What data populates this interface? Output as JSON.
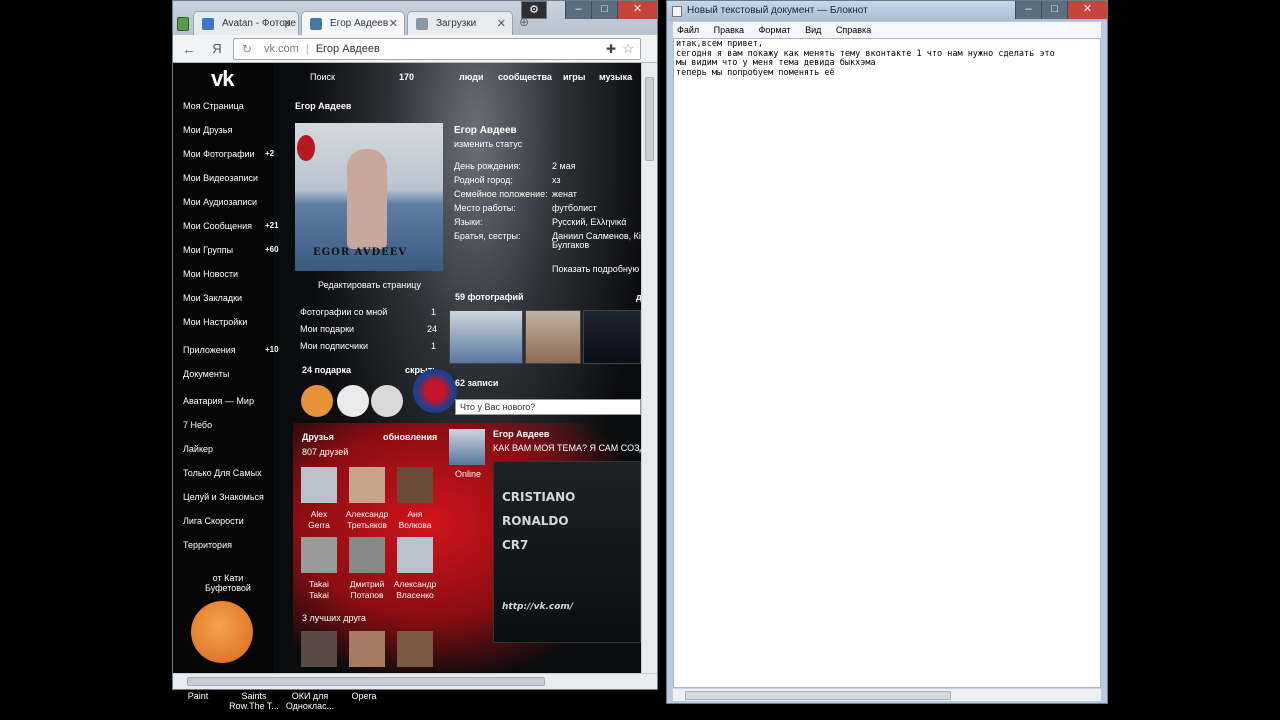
{
  "browser": {
    "tabs": [
      {
        "label": "Avatan - Фоторе"
      },
      {
        "label": "Егор Авдеев"
      },
      {
        "label": "Загрузки"
      }
    ],
    "url_domain": "vk.com",
    "url_title": "Егор Авдеев",
    "back_icon": "arrow-left-icon",
    "yandex_label": "Я"
  },
  "vk": {
    "logo": "vk",
    "topnav": {
      "search": "Поиск",
      "count": "170",
      "people": "люди",
      "communities": "сообщества",
      "games": "игры",
      "music": "музыка"
    },
    "menu": [
      {
        "label": "Моя Страница",
        "badge": ""
      },
      {
        "label": "Мои Друзья",
        "badge": ""
      },
      {
        "label": "Мои Фотографии",
        "badge": "+2"
      },
      {
        "label": "Мои Видеозаписи",
        "badge": ""
      },
      {
        "label": "Мои Аудиозаписи",
        "badge": ""
      },
      {
        "label": "Мои Сообщения",
        "badge": "+21"
      },
      {
        "label": "Мои Группы",
        "badge": "+60"
      },
      {
        "label": "Мои Новости",
        "badge": ""
      },
      {
        "label": "Мои Закладки",
        "badge": ""
      },
      {
        "label": "Мои Настройки",
        "badge": ""
      },
      {
        "label": "Приложения",
        "badge": "+10"
      },
      {
        "label": "Документы",
        "badge": ""
      },
      {
        "label": "Аватария — Мир",
        "badge": ""
      },
      {
        "label": "7 Небо",
        "badge": ""
      },
      {
        "label": "Лайкер",
        "badge": ""
      },
      {
        "label": "Только Для Самых",
        "badge": ""
      },
      {
        "label": "Целуй и Знакомься",
        "badge": ""
      },
      {
        "label": "Лига Скорости",
        "badge": ""
      },
      {
        "label": "Территория",
        "badge": ""
      }
    ],
    "gift_from": "от Кати\nБуфетовой",
    "page_owner": "Егор Авдеев",
    "avatar_sign": "EGOR AVDEEV",
    "edit_page": "Редактировать страницу",
    "counters": [
      {
        "label": "Фотографии со мной",
        "value": "1"
      },
      {
        "label": "Мои подарки",
        "value": "24"
      },
      {
        "label": "Мои подписчики",
        "value": "1"
      }
    ],
    "gifts_header": "24 подарка",
    "gifts_hide": "скрыть",
    "friends_header": "Друзья",
    "friends_updates": "обновления",
    "friends_count": "807 друзей",
    "friends": [
      {
        "first": "Alex",
        "last": "Gerra"
      },
      {
        "first": "Александр",
        "last": "Третьяков"
      },
      {
        "first": "Аня",
        "last": "Волкова"
      },
      {
        "first": "Takai",
        "last": "Takai"
      },
      {
        "first": "Дмитрий",
        "last": "Потапов"
      },
      {
        "first": "Александр",
        "last": "Власенко"
      }
    ],
    "best_friends": "3 лучших друга",
    "profile": {
      "name": "Егор Авдеев",
      "status": "изменить статус",
      "rows": [
        {
          "key": "День рождения:",
          "val": "2 мая"
        },
        {
          "key": "Родной город:",
          "val": "хз"
        },
        {
          "key": "Семейное положение:",
          "val": "женат"
        },
        {
          "key": "Место работы:",
          "val": "футболист"
        },
        {
          "key": "Языки:",
          "val": "Русский, Ελληνικά"
        },
        {
          "key": "Братья, сестры:",
          "val": "Даниил Салменов, Кі"
        }
      ],
      "sibling2": "Булгаков",
      "show_more": "Показать подробную"
    },
    "photos_header": "59 фотографий",
    "photos_more": "д",
    "posts_header": "62 записи",
    "status_placeholder": "Что у Вас нового?",
    "post": {
      "author": "Егор Авдеев",
      "text": "КАК ВАМ МОЯ ТЕМА? Я САМ СОЗДА",
      "online": "Online",
      "img_lines": [
        "CRISTIANO",
        "RONALDO",
        "CR7"
      ],
      "img_url": "http://vk.com/"
    }
  },
  "notepad": {
    "title": "Новый текстовый документ — Блокнот",
    "menu": [
      "Файл",
      "Правка",
      "Формат",
      "Вид",
      "Справка"
    ],
    "lines": [
      "итак,всем привет,",
      "сегодня я вам покажу как менять тему вконтакте 1 что нам нужно сделать это",
      "мы видим что у меня тема девида быкхэма",
      "теперь мы попробуем поменять её"
    ]
  },
  "taskbar": [
    {
      "label": "Paint"
    },
    {
      "label": "Saints\nRow.The T..."
    },
    {
      "label": "ОКИ для\nОдноклас..."
    },
    {
      "label": "Opera"
    }
  ],
  "colors": {
    "chrome_frame": "#b7c3cf",
    "close_red": "#c4453a",
    "vk_bg": "#060606",
    "red_shirt": "#d2141b"
  }
}
